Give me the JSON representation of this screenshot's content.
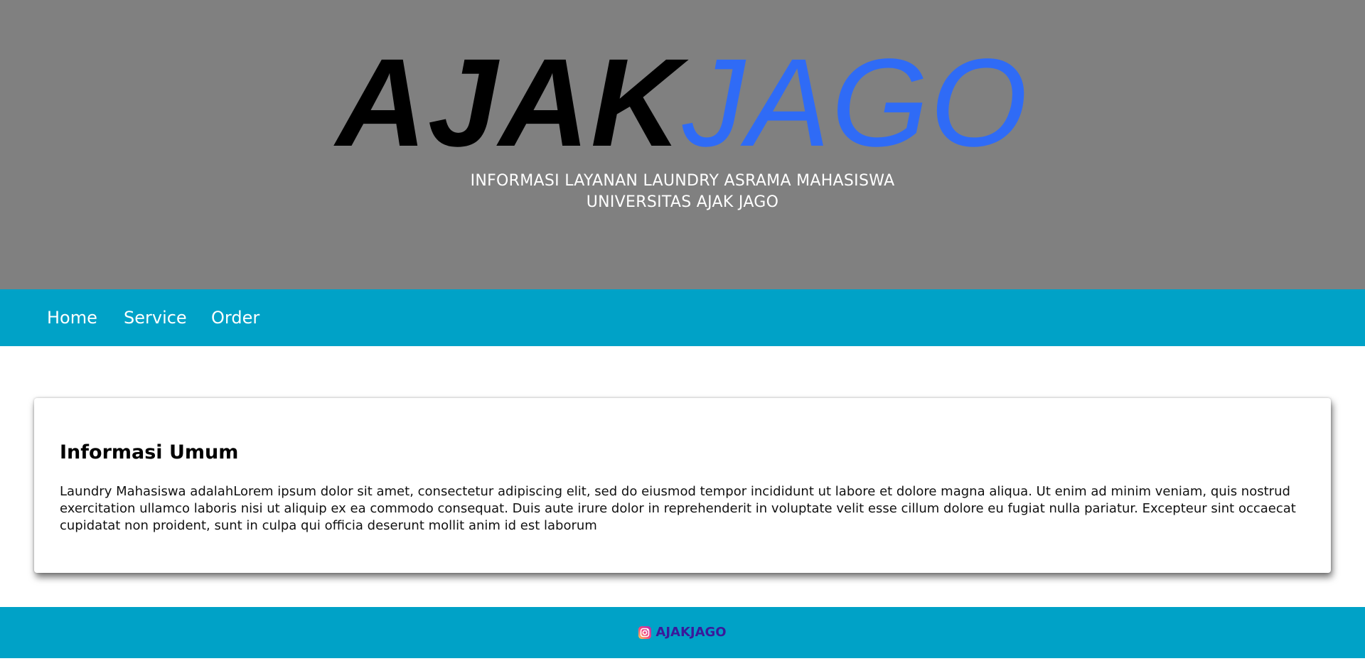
{
  "header": {
    "logo_part_1": "AJAK",
    "logo_part_2": "JAGO",
    "tagline_line_1": "INFORMASI LAYANAN LAUNDRY ASRAMA MAHASISWA",
    "tagline_line_2": "UNIVERSITAS AJAK JAGO"
  },
  "nav": {
    "items": [
      {
        "label": "Home"
      },
      {
        "label": "Service"
      },
      {
        "label": "Order"
      }
    ]
  },
  "card": {
    "title": "Informasi Umum",
    "body": "Laundry Mahasiswa adalahLorem ipsum dolor sit amet, consectetur adipiscing elit, sed do eiusmod tempor incididunt ut labore et dolore magna aliqua. Ut enim ad minim veniam, quis nostrud exercitation ullamco laboris nisi ut aliquip ex ea commodo consequat. Duis aute irure dolor in reprehenderit in voluptate velit esse cillum dolore eu fugiat nulla pariatur. Excepteur sint occaecat cupidatat non proident, sunt in culpa qui officia deserunt mollit anim id est laborum"
  },
  "footer": {
    "social_label": "AJAKJAGO",
    "social_icon": "instagram-icon"
  },
  "colors": {
    "hero_bg": "#808080",
    "accent": "#00a2c7",
    "logo_blue": "#2f6bf6",
    "footer_link": "#3a1a9a"
  }
}
